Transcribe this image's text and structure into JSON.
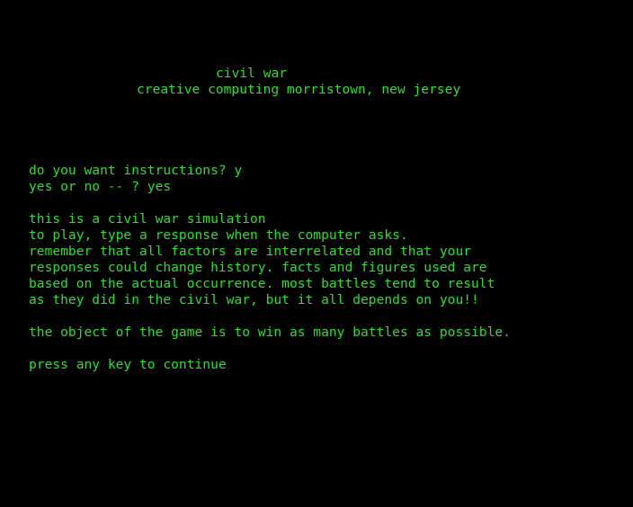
{
  "palette": {
    "background": "#000000",
    "text": "#33dd33"
  },
  "header": {
    "title": "civil war",
    "subtitle": "creative computing morristown, new jersey"
  },
  "dialog": {
    "prompt_instructions": "do you want instructions? y",
    "prompt_yes_no": "yes or no -- ? yes"
  },
  "instructions": {
    "lines": [
      "this is a civil war simulation",
      "to play, type a response when the computer asks.",
      "remember that all factors are interrelated and that your",
      "responses could change history. facts and figures used are",
      "based on the actual occurrence. most battles tend to result",
      "as they did in the civil war, but it all depends on you!!"
    ],
    "objective": "the object of the game is to win as many battles as possible."
  },
  "footer": {
    "continue_prompt": "press any key to continue"
  }
}
